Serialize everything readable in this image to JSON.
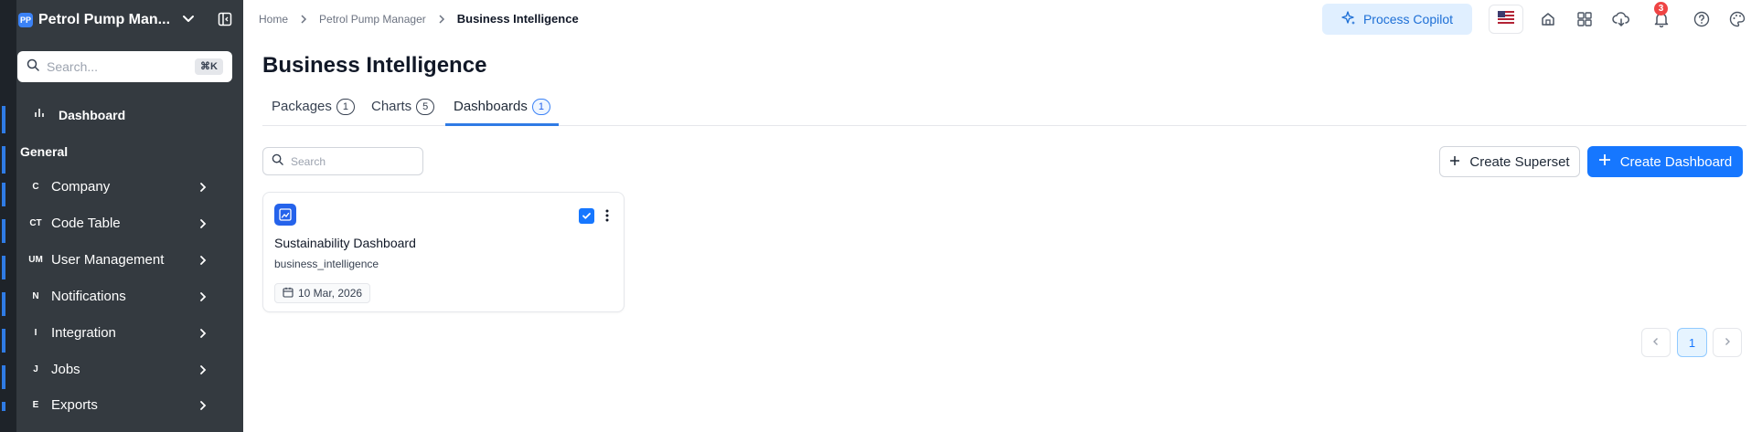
{
  "sidebar": {
    "brand": "Petrol Pump Man...",
    "brand_logo": "PP",
    "search_placeholder": "Search...",
    "search_shortcut": "⌘K",
    "dashboard_label": "Dashboard",
    "section_title": "General",
    "items": [
      {
        "abbr": "C",
        "label": "Company"
      },
      {
        "abbr": "CT",
        "label": "Code Table"
      },
      {
        "abbr": "UM",
        "label": "User Management"
      },
      {
        "abbr": "N",
        "label": "Notifications"
      },
      {
        "abbr": "I",
        "label": "Integration"
      },
      {
        "abbr": "J",
        "label": "Jobs"
      },
      {
        "abbr": "E",
        "label": "Exports"
      }
    ]
  },
  "breadcrumb": {
    "items": [
      "Home",
      "Petrol Pump Manager"
    ],
    "current": "Business Intelligence"
  },
  "header": {
    "copilot_label": "Process Copilot",
    "notification_count": "3"
  },
  "main": {
    "title": "Business Intelligence",
    "tabs": [
      {
        "label": "Packages",
        "count": "1"
      },
      {
        "label": "Charts",
        "count": "5"
      },
      {
        "label": "Dashboards",
        "count": "1"
      }
    ],
    "active_tab": "Dashboards",
    "search_placeholder": "Search",
    "create_superset_label": "Create Superset",
    "create_dashboard_label": "Create Dashboard"
  },
  "cards": [
    {
      "title": "Sustainability Dashboard",
      "subtitle": "business_intelligence",
      "date": "10 Mar, 2026",
      "checked": true
    }
  ],
  "pagination": {
    "current_page": "1"
  },
  "colors": {
    "sidebar_bg": "#343a40",
    "accent": "#1677ff",
    "copilot_bg": "#e0efff",
    "badge": "#ef4444"
  }
}
